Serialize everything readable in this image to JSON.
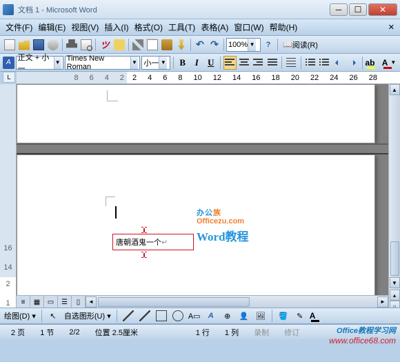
{
  "title": "文档 1 - Microsoft Word",
  "menu": {
    "file": "文件(F)",
    "edit": "编辑(E)",
    "view": "视图(V)",
    "insert": "插入(I)",
    "format": "格式(O)",
    "tools": "工具(T)",
    "table": "表格(A)",
    "window": "窗口(W)",
    "help": "帮助(H)"
  },
  "toolbar": {
    "zoom": "100%",
    "read": "阅读(R)"
  },
  "format_bar": {
    "style": "正文 + 小一",
    "font": "Times New Roman",
    "size": "小一",
    "bold": "B",
    "italic": "I",
    "underline": "U",
    "fontcolor_letter": "A"
  },
  "ruler": {
    "neg": [
      "8",
      "6",
      "4",
      "2"
    ],
    "tab": "L",
    "pos": [
      "2",
      "4",
      "6",
      "8",
      "10",
      "12",
      "14",
      "16",
      "18",
      "20",
      "22",
      "24",
      "26",
      "28"
    ]
  },
  "ruler_v": {
    "neg": [
      "16",
      "14"
    ],
    "pos": [
      "2",
      "1"
    ]
  },
  "document": {
    "footer_text": "唐朝酒鬼一个"
  },
  "watermark": {
    "line1a": "办公",
    "line1b": "族",
    "line2": "Officezu.com",
    "line3": "Word教程"
  },
  "draw": {
    "label": "绘图(D)",
    "autoshape": "自选图形(U)"
  },
  "status": {
    "page": "2 页",
    "sec": "1 节",
    "pages": "2/2",
    "pos": "位置 2.5厘米",
    "line": "1 行",
    "col": "1 列",
    "rec": "录制",
    "rev": "修订"
  },
  "credit": {
    "l1": "Office教程学习网",
    "l2": "www.office68.com"
  }
}
